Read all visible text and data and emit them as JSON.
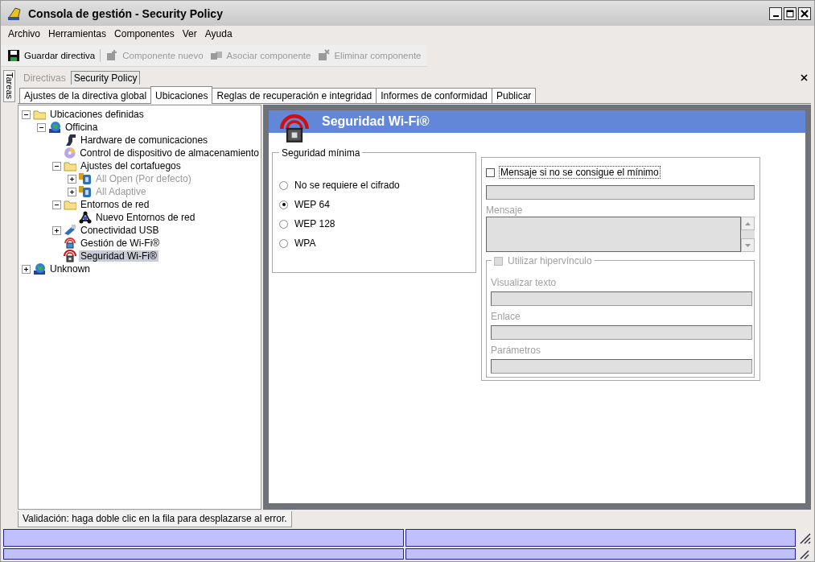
{
  "window": {
    "title": "Consola de gestión - Security Policy"
  },
  "menu": [
    "Archivo",
    "Herramientas",
    "Componentes",
    "Ver",
    "Ayuda"
  ],
  "toolbar": [
    {
      "label": "Guardar directiva",
      "kind": "save",
      "disabled": false
    },
    {
      "label": "Componente nuevo",
      "kind": "new",
      "disabled": true
    },
    {
      "label": "Asociar componente",
      "kind": "link",
      "disabled": true
    },
    {
      "label": "Eliminar componente",
      "kind": "delete",
      "disabled": true
    }
  ],
  "side_tab": "Tareas",
  "doc_tabs": [
    {
      "label": "Directivas",
      "selected": false
    },
    {
      "label": "Security Policy",
      "selected": true
    }
  ],
  "tabs": [
    {
      "label": "Ajustes de la directiva global",
      "selected": false
    },
    {
      "label": "Ubicaciones",
      "selected": true
    },
    {
      "label": "Reglas de recuperación e integridad",
      "selected": false
    },
    {
      "label": "Informes de conformidad",
      "selected": false
    },
    {
      "label": "Publicar",
      "selected": false
    }
  ],
  "tree": [
    {
      "label": "Ubicaciones definidas",
      "kind": "folder",
      "expanded": true,
      "disabled": false,
      "selected": false,
      "children": [
        {
          "label": "Officina",
          "kind": "globe",
          "expanded": true,
          "disabled": false,
          "selected": false,
          "children": [
            {
              "label": "Hardware de comunicaciones",
              "kind": "hardware",
              "disabled": false,
              "selected": false
            },
            {
              "label": "Control de dispositivo de almacenamiento",
              "kind": "disc",
              "disabled": false,
              "selected": false
            },
            {
              "label": "Ajustes del cortafuegos",
              "kind": "folder",
              "expanded": true,
              "disabled": false,
              "selected": false,
              "children": [
                {
                  "label": "All Open (Por defecto)",
                  "kind": "firewall",
                  "expanded": false,
                  "disabled": true,
                  "selected": false
                },
                {
                  "label": "All Adaptive",
                  "kind": "firewall",
                  "expanded": false,
                  "disabled": true,
                  "selected": false
                }
              ]
            },
            {
              "label": "Entornos de red",
              "kind": "folder",
              "expanded": true,
              "disabled": false,
              "selected": false,
              "children": [
                {
                  "label": "Nuevo Entornos de red",
                  "kind": "network",
                  "disabled": false,
                  "selected": false
                }
              ]
            },
            {
              "label": "Conectividad USB",
              "kind": "usb",
              "expanded": false,
              "disabled": false,
              "selected": false
            },
            {
              "label": "Gestión de Wi-Fi®",
              "kind": "wifi",
              "disabled": false,
              "selected": false
            },
            {
              "label": "Seguridad Wi-Fi®",
              "kind": "wifi-lock",
              "disabled": false,
              "selected": true
            }
          ]
        }
      ]
    },
    {
      "label": "Unknown",
      "kind": "globe",
      "expanded": false,
      "disabled": false,
      "selected": false
    }
  ],
  "panel": {
    "title": "Seguridad Wi-Fi®",
    "group_title": "Seguridad mínima",
    "options": [
      {
        "label": "No se requiere el cifrado",
        "selected": false
      },
      {
        "label": "WEP 64",
        "selected": true
      },
      {
        "label": "WEP 128",
        "selected": false
      },
      {
        "label": "WPA",
        "selected": false
      }
    ],
    "message_check": {
      "label": "Mensaje si no se consigue el mínimo",
      "checked": false
    },
    "message_label": "Mensaje",
    "link_check": {
      "label": "Utilizar hipervínculo",
      "checked": false
    },
    "fields": [
      "Visualizar texto",
      "Enlace",
      "Parámetros"
    ]
  },
  "validation_tab": "Validación: haga doble clic en la fila para desplazarse al error."
}
